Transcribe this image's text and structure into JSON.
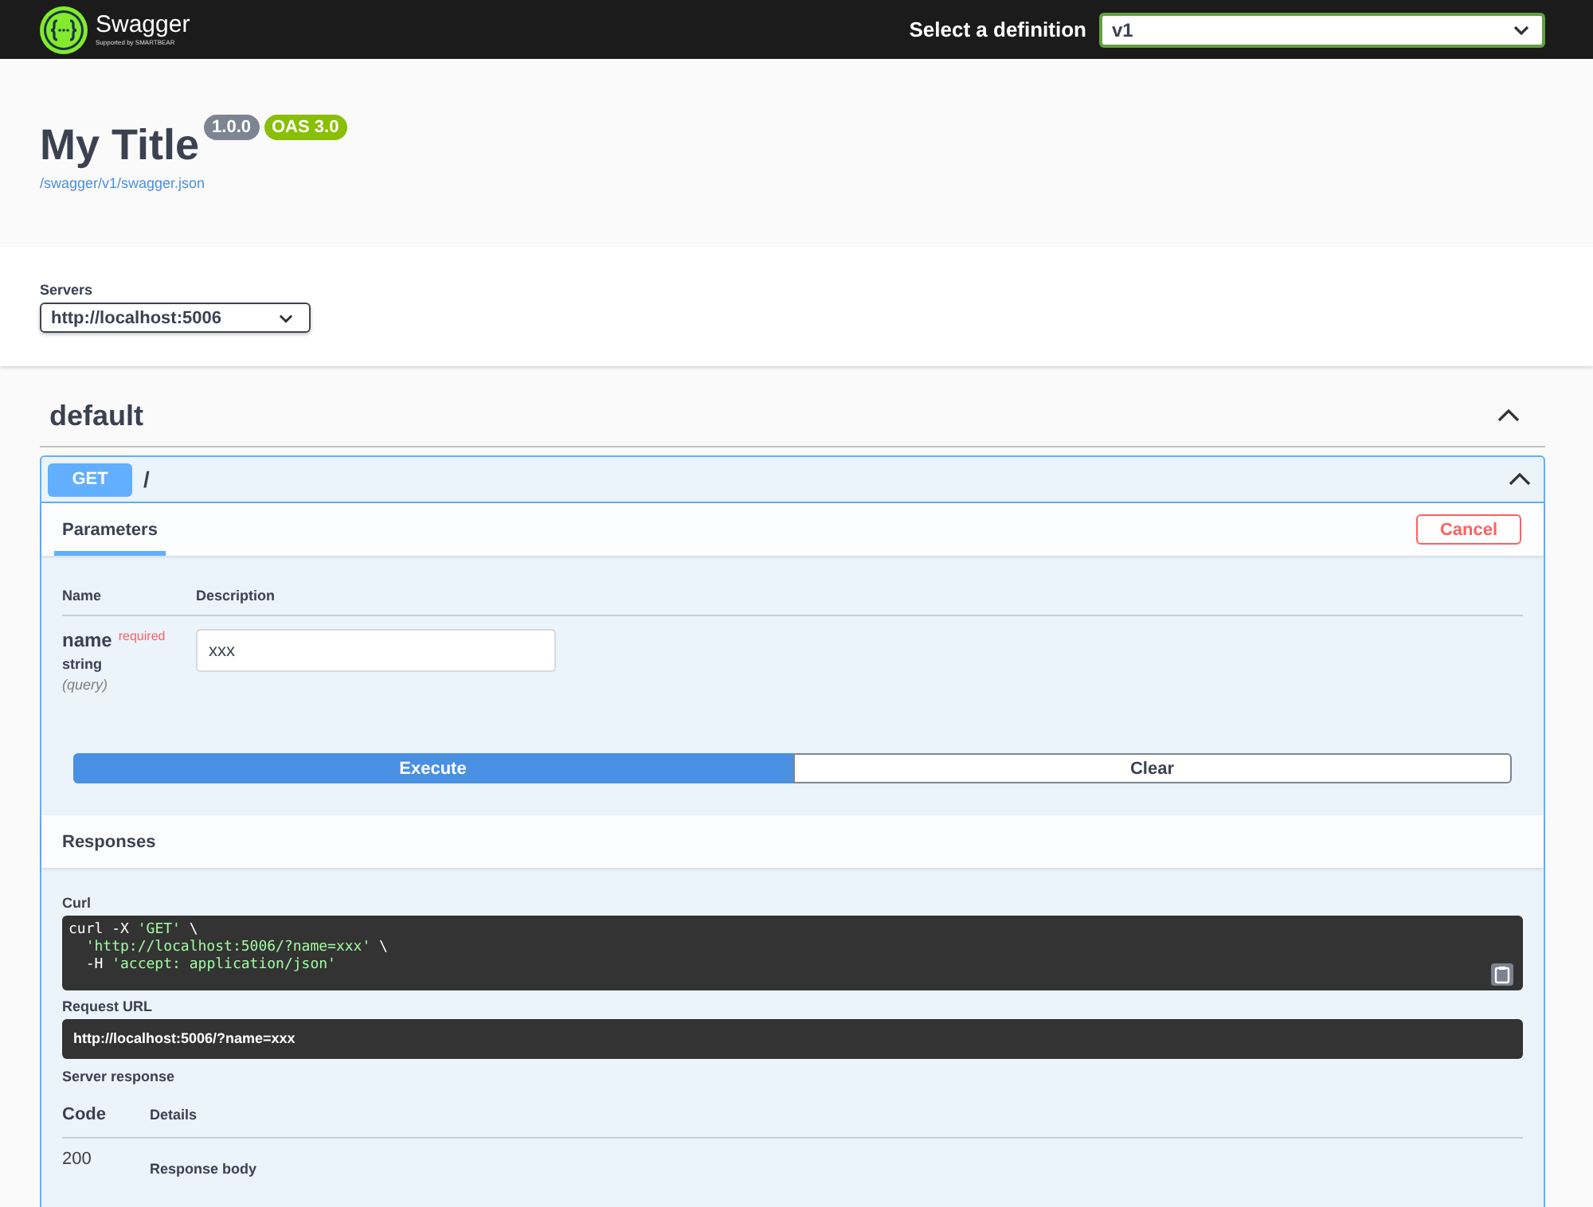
{
  "topbar": {
    "brand": "Swagger",
    "tagline": "Supported by SMARTBEAR",
    "definition_label": "Select a definition",
    "definition_value": "v1"
  },
  "info": {
    "title": "My Title",
    "version": "1.0.0",
    "oas": "OAS 3.0",
    "url": "/swagger/v1/swagger.json"
  },
  "servers": {
    "label": "Servers",
    "value": "http://localhost:5006"
  },
  "tag": {
    "name": "default",
    "expanded": true
  },
  "operation": {
    "method": "GET",
    "path": "/",
    "expanded": true,
    "tabs": [
      {
        "label": "Parameters",
        "selected": true
      }
    ],
    "cancel": "Cancel",
    "param_columns": [
      "Name",
      "Description"
    ],
    "parameters": [
      {
        "name": "name",
        "required_label": "required",
        "type": "string",
        "location": "(query)",
        "value": "xxx"
      }
    ],
    "execute": "Execute",
    "clear": "Clear",
    "responses_title": "Responses",
    "curl_label": "Curl",
    "curl_lines": [
      [
        {
          "kind": "plain",
          "text": "curl -X "
        },
        {
          "kind": "string",
          "text": "'GET'"
        },
        {
          "kind": "plain",
          "text": " \\"
        }
      ],
      [
        {
          "kind": "string",
          "text": "'http://localhost:5006/?name=xxx'"
        },
        {
          "kind": "plain",
          "text": " \\"
        }
      ],
      [
        {
          "kind": "plain",
          "text": "-H "
        },
        {
          "kind": "string",
          "text": "'accept: application/json'"
        }
      ]
    ],
    "request_url_label": "Request URL",
    "request_url": "http://localhost:5006/?name=xxx",
    "server_response_label": "Server response",
    "response_columns": [
      "Code",
      "Details"
    ],
    "responses": [
      {
        "code": "200",
        "details_label": "Response body"
      }
    ]
  }
}
